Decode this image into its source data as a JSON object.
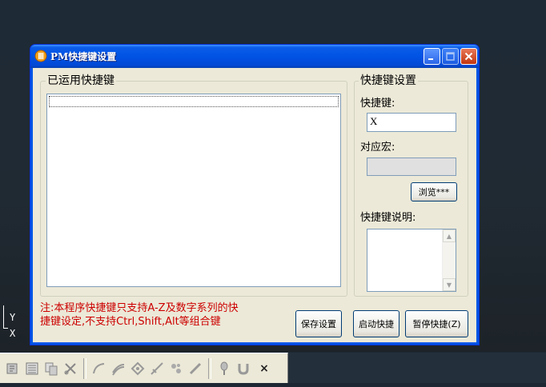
{
  "window": {
    "title": "PM快捷键设置"
  },
  "left_group": {
    "title": "已运用快捷键",
    "items": []
  },
  "right_group": {
    "title": "快捷键设置",
    "hotkey_label": "快捷键:",
    "hotkey_value": "X",
    "macro_label": "对应宏:",
    "macro_value": "",
    "browse_label": "浏览***",
    "desc_label": "快捷键说明:",
    "desc_value": ""
  },
  "footer": {
    "note_line1": "注:本程序快捷键只支持A-Z及数字系列的快",
    "note_line2": "捷键设定,不支持Ctrl,Shift,Alt等组合键",
    "save_label": "保存设置",
    "start_label": "启动快捷",
    "pause_label": "暂停快捷(Z)"
  },
  "axis": {
    "y": "Y",
    "x": "X"
  },
  "toolbar": {
    "icons": [
      "properties-icon",
      "list-icon",
      "copy-icon",
      "trim-icon",
      "arc-icon",
      "offset-icon",
      "node-icon",
      "dimension-icon",
      "pattern-icon",
      "line-icon",
      "pin-icon",
      "magnet-icon"
    ],
    "close_glyph": "×"
  },
  "colors": {
    "title_bar": "#0153e4",
    "note_text": "#cc0000",
    "dialog_bg": "#ece9d8"
  }
}
